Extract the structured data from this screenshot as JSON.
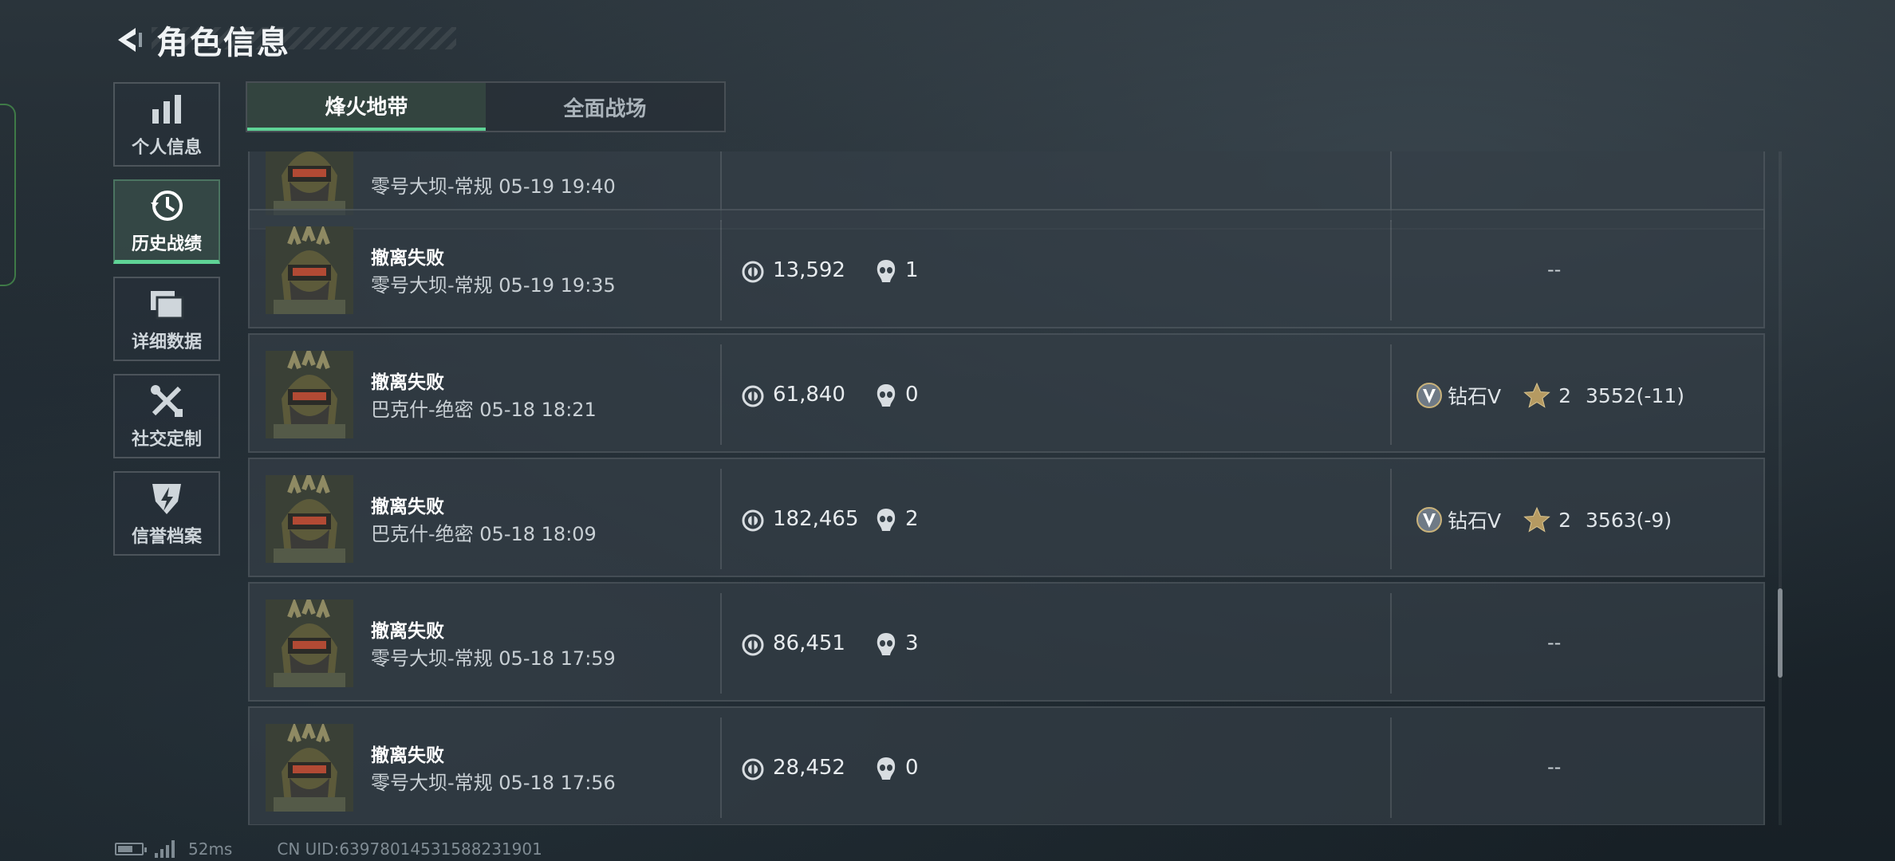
{
  "header": {
    "title": "角色信息"
  },
  "sidebar": {
    "items": [
      {
        "label": "个人信息",
        "icon": "bar-chart-icon",
        "active": false
      },
      {
        "label": "历史战绩",
        "icon": "history-clock-icon",
        "active": true
      },
      {
        "label": "详细数据",
        "icon": "folder-icon",
        "active": false
      },
      {
        "label": "社交定制",
        "icon": "tools-icon",
        "active": false
      },
      {
        "label": "信誉档案",
        "icon": "shield-lightning-icon",
        "active": false
      }
    ]
  },
  "tabs": [
    {
      "label": "烽火地带",
      "active": true
    },
    {
      "label": "全面战场",
      "active": false
    }
  ],
  "matches": [
    {
      "result": "",
      "map": "零号大坝-常规 05-19 19:40",
      "money": "",
      "kills": "",
      "rank": null,
      "partial": true
    },
    {
      "result": "撤离失败",
      "map": "零号大坝-常规 05-19 19:35",
      "money": "13,592",
      "kills": "1",
      "rank": null
    },
    {
      "result": "撤离失败",
      "map": "巴克什-绝密 05-18 18:21",
      "money": "61,840",
      "kills": "0",
      "rank": {
        "tier": "钻石V",
        "stars": "2",
        "score": "3552(-11)"
      }
    },
    {
      "result": "撤离失败",
      "map": "巴克什-绝密 05-18 18:09",
      "money": "182,465",
      "kills": "2",
      "rank": {
        "tier": "钻石V",
        "stars": "2",
        "score": "3563(-9)"
      }
    },
    {
      "result": "撤离失败",
      "map": "零号大坝-常规 05-18 17:59",
      "money": "86,451",
      "kills": "3",
      "rank": null
    },
    {
      "result": "撤离失败",
      "map": "零号大坝-常规 05-18 17:56",
      "money": "28,452",
      "kills": "0",
      "rank": null
    }
  ],
  "empty_rank": "--",
  "status": {
    "ping": "52ms",
    "uid": "CN UID:639780145315882319​01"
  },
  "colors": {
    "accent": "#5fd396",
    "panel": "#343e46"
  }
}
